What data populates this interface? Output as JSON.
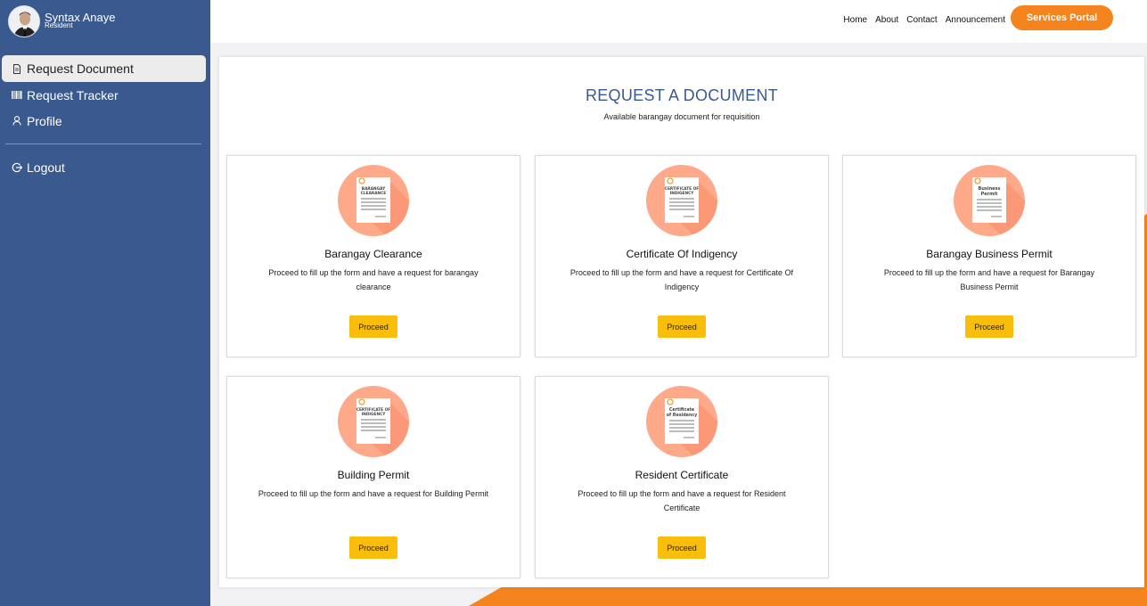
{
  "user": {
    "name": "Syntax Anaye",
    "role": "Resident"
  },
  "sidebar": {
    "items": [
      {
        "label": "Request Document",
        "icon": "document-icon",
        "active": true
      },
      {
        "label": "Request Tracker",
        "icon": "barcode-icon",
        "active": false
      },
      {
        "label": "Profile",
        "icon": "user-icon",
        "active": false
      }
    ],
    "logout": {
      "label": "Logout",
      "icon": "logout-icon"
    }
  },
  "topnav": {
    "links": [
      "Home",
      "About",
      "Contact",
      "Announcement"
    ],
    "portal_label": "Services Portal"
  },
  "main": {
    "title": "REQUEST A DOCUMENT",
    "subtitle": "Available barangay document for requisition",
    "cards": [
      {
        "title": "Barangay Clearance",
        "description": "Proceed to fill up the form and have a request for barangay clearance",
        "button": "Proceed",
        "emblem_line1": "BARANGAY",
        "emblem_line2": "CLEARANCE"
      },
      {
        "title": "Certificate Of Indigency",
        "description": "Proceed to fill up the form and have a request for Certificate Of Indigency",
        "button": "Proceed",
        "emblem_line1": "CERTIFICATE OF",
        "emblem_line2": "INDIGENCY"
      },
      {
        "title": "Barangay Business Permit",
        "description": "Proceed to fill up the form and have a request for Barangay Business Permit",
        "button": "Proceed",
        "emblem_line1": "Business",
        "emblem_line2": "Permit"
      },
      {
        "title": "Building Permit",
        "description": "Proceed to fill up the form and have a request for Building Permit",
        "button": "Proceed",
        "emblem_line1": "CERTIFICATE OF",
        "emblem_line2": "INDIGENCY"
      },
      {
        "title": "Resident Certificate",
        "description": "Proceed to fill up the form and have a request for Resident Certificate",
        "button": "Proceed",
        "emblem_line1": "Certificate",
        "emblem_line2": "of Residency"
      }
    ]
  },
  "colors": {
    "sidebar": "#3a5a8f",
    "accent_orange": "#f5841f",
    "proceed_yellow": "#f9bd0b",
    "emblem_circle": "#fda98a"
  }
}
